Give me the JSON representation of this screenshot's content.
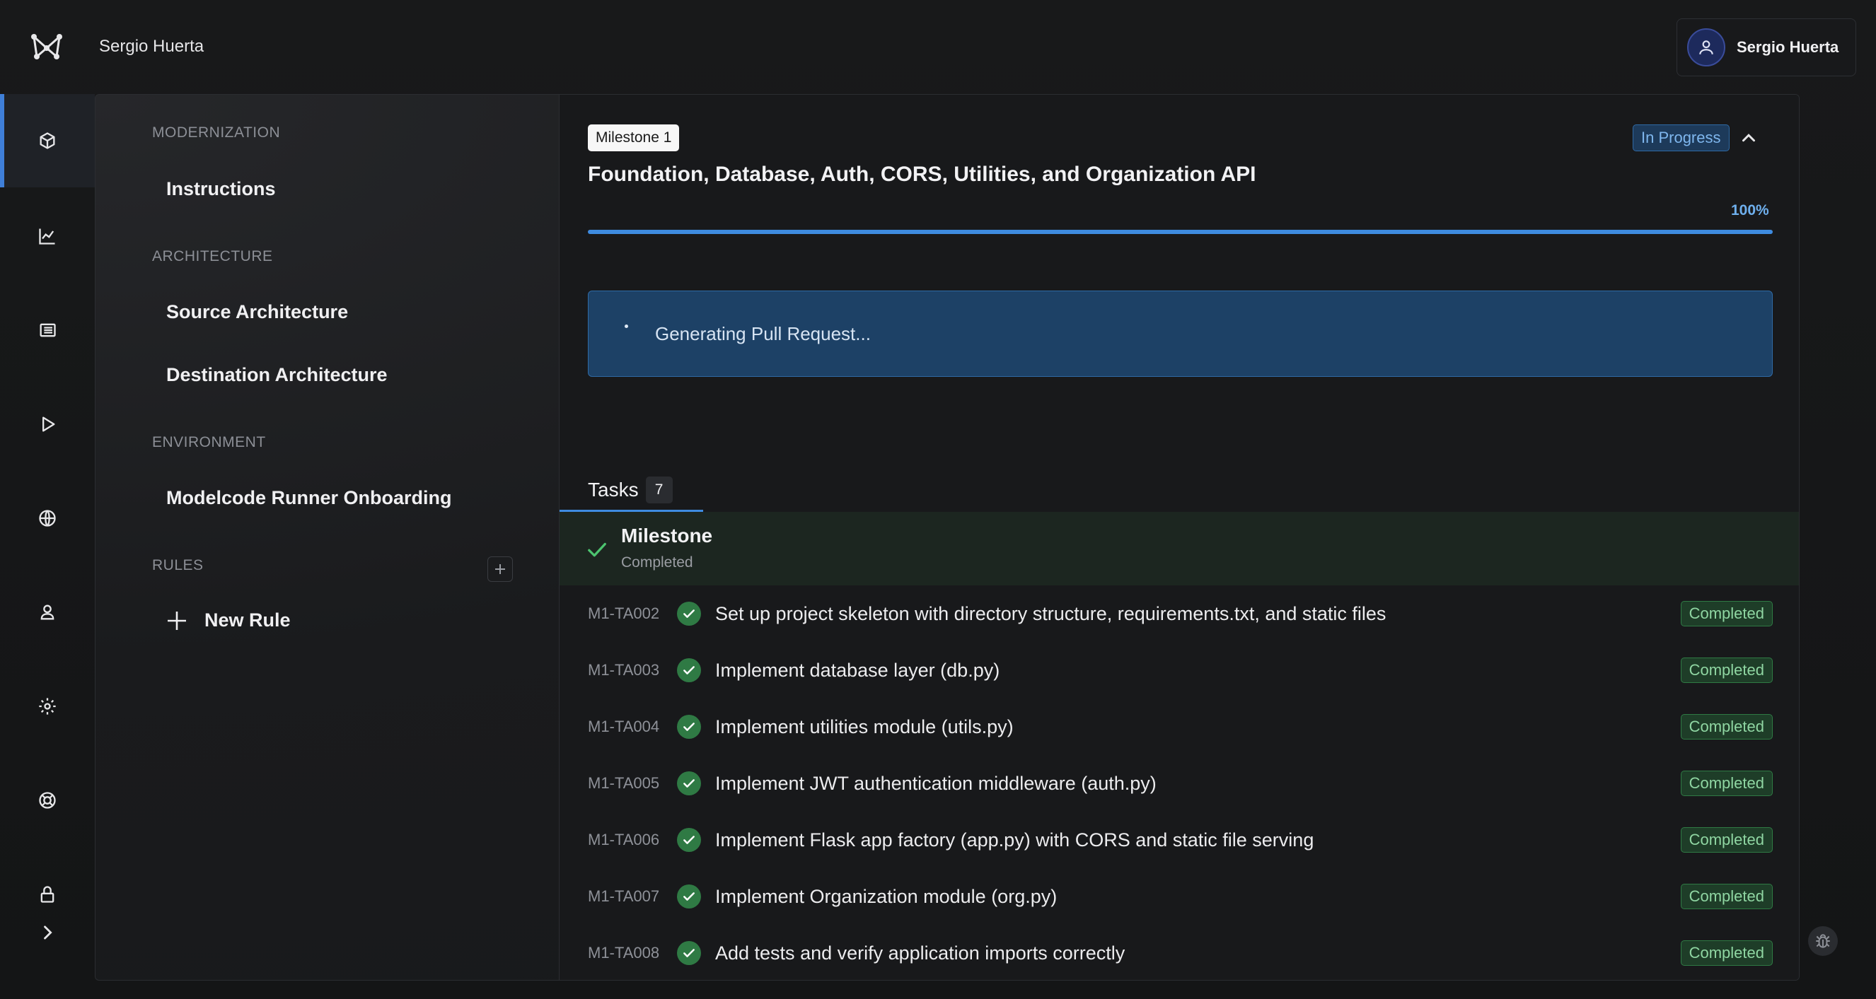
{
  "header": {
    "org_name": "Sergio Huerta",
    "user_name": "Sergio Huerta"
  },
  "rail": {
    "items": [
      {
        "icon": "box-icon",
        "active": true
      },
      {
        "icon": "chart-icon",
        "active": false
      },
      {
        "icon": "list-icon",
        "active": false
      },
      {
        "icon": "play-icon",
        "active": false
      },
      {
        "icon": "globe-icon",
        "active": false
      },
      {
        "icon": "users-icon",
        "active": false
      },
      {
        "icon": "gear-icon",
        "active": false
      },
      {
        "icon": "lifebuoy-icon",
        "active": false
      },
      {
        "icon": "lock-icon",
        "active": false
      },
      {
        "icon": "chevron-right-icon",
        "active": false
      }
    ]
  },
  "sidebar": {
    "sections": {
      "modernization": "MODERNIZATION",
      "architecture": "ARCHITECTURE",
      "environment": "ENVIRONMENT",
      "rules": "RULES"
    },
    "links": {
      "instructions": "Instructions",
      "source_architecture": "Source Architecture",
      "destination_architecture": "Destination Architecture",
      "runner_onboarding": "Modelcode Runner Onboarding",
      "new_rule": "New Rule"
    }
  },
  "milestone": {
    "badge": "Milestone 1",
    "status": "In Progress",
    "title": "Foundation, Database, Auth, CORS, Utilities, and Organization API",
    "progress_label": "100%",
    "progress": 1.0,
    "pr_message": "Generating Pull Request..."
  },
  "tasks": {
    "tab_label": "Tasks",
    "count": "7",
    "milestone_row": {
      "title": "Milestone",
      "status": "Completed"
    },
    "items": [
      {
        "id": "M1-TA002",
        "title": "Set up project skeleton with directory structure, requirements.txt, and static files",
        "status": "Completed"
      },
      {
        "id": "M1-TA003",
        "title": "Implement database layer (db.py)",
        "status": "Completed"
      },
      {
        "id": "M1-TA004",
        "title": "Implement utilities module (utils.py)",
        "status": "Completed"
      },
      {
        "id": "M1-TA005",
        "title": "Implement JWT authentication middleware (auth.py)",
        "status": "Completed"
      },
      {
        "id": "M1-TA006",
        "title": "Implement Flask app factory (app.py) with CORS and static file serving",
        "status": "Completed"
      },
      {
        "id": "M1-TA007",
        "title": "Implement Organization module (org.py)",
        "status": "Completed"
      },
      {
        "id": "M1-TA008",
        "title": "Add tests and verify application imports correctly",
        "status": "Completed"
      }
    ]
  },
  "colors": {
    "accent": "#3e8be0",
    "success": "#2f7a44",
    "success_text": "#8fd6a2",
    "in_progress": "#7fb7ee"
  }
}
